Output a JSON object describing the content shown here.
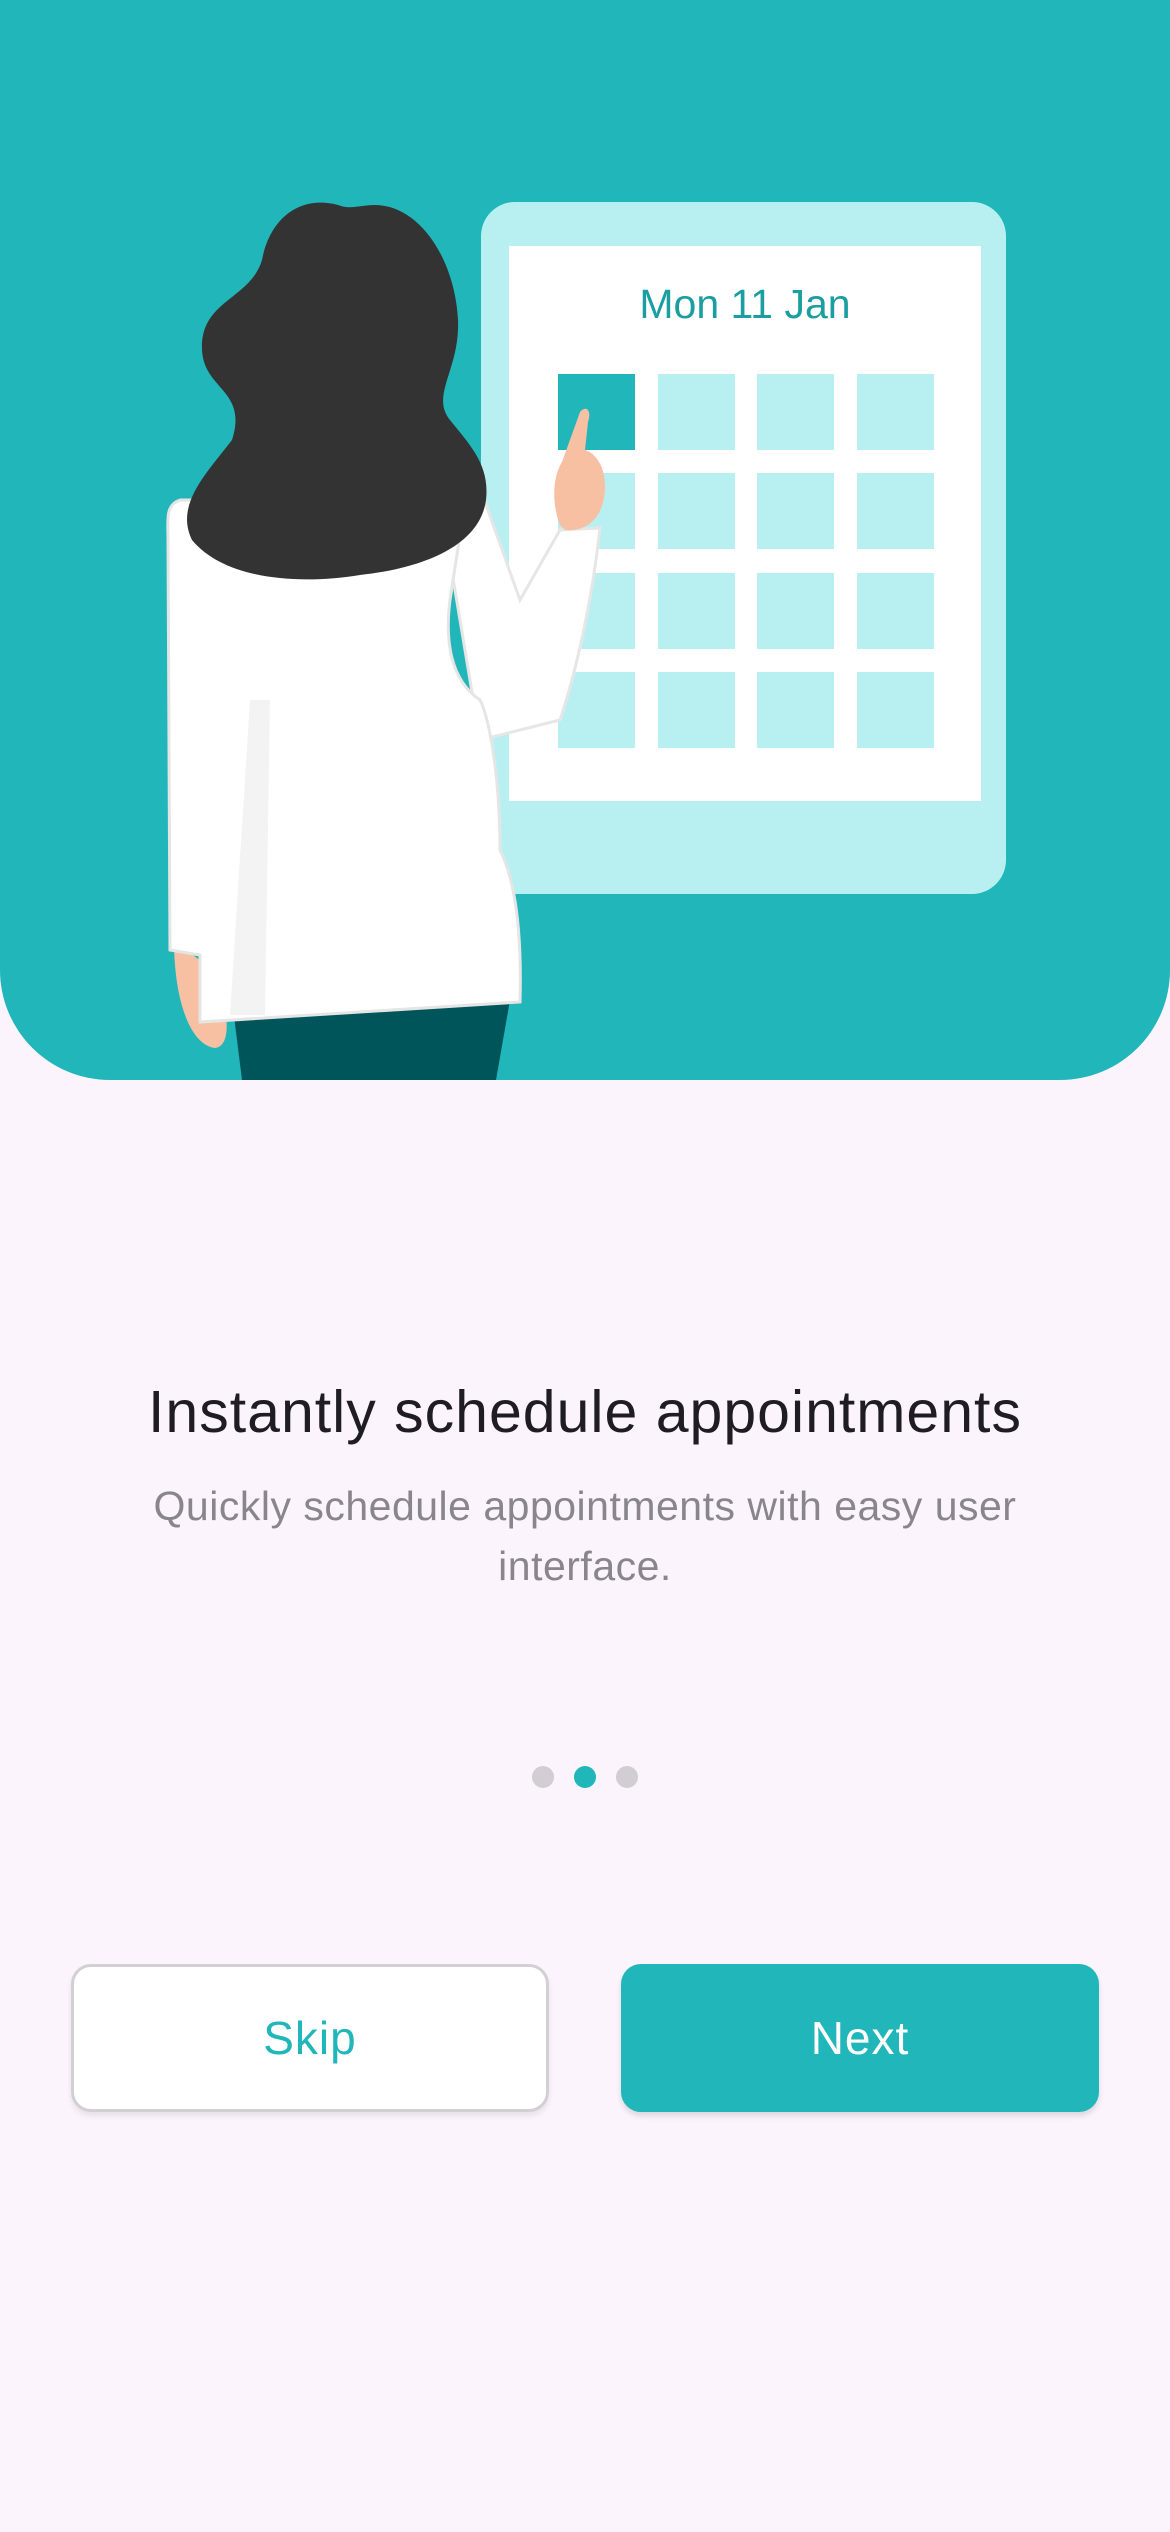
{
  "illustration": {
    "calendar_date_label": "Mon 11 Jan"
  },
  "onboarding": {
    "title": "Instantly schedule appointments",
    "subtitle": "Quickly schedule appointments with easy user interface.",
    "page_indicator": {
      "total": 3,
      "current": 2
    }
  },
  "actions": {
    "skip_label": "Skip",
    "next_label": "Next"
  },
  "colors": {
    "accent": "#21b6b9",
    "background": "#fcf4fc",
    "calendar_tile": "#b8f0f2",
    "hair": "#333333",
    "pants": "#00555a"
  }
}
